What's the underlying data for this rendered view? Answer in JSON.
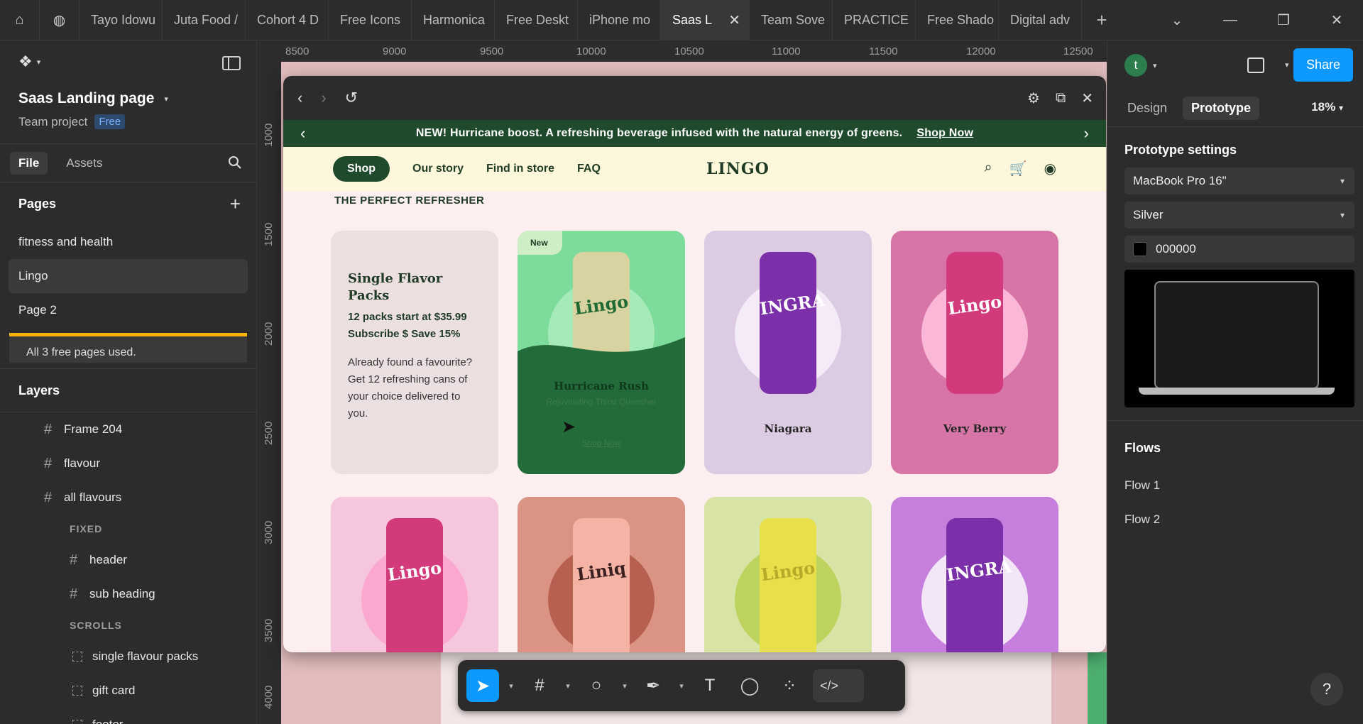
{
  "browser": {
    "tabs": [
      {
        "label": "Tayo Idowu"
      },
      {
        "label": "Juta Food /"
      },
      {
        "label": "Cohort 4 D"
      },
      {
        "label": "Free Icons"
      },
      {
        "label": "Harmonica"
      },
      {
        "label": "Free Deskt"
      },
      {
        "label": "iPhone mo"
      },
      {
        "label": "Saas L"
      },
      {
        "label": "Team Sove"
      },
      {
        "label": "PRACTICE"
      },
      {
        "label": "Free Shado"
      },
      {
        "label": "Digital adv"
      }
    ],
    "active_tab_index": 7
  },
  "left_panel": {
    "project_title": "Saas Landing page",
    "team_label": "Team project",
    "plan_badge": "Free",
    "file_tab": "File",
    "assets_tab": "Assets",
    "pages_heading": "Pages",
    "pages": [
      {
        "label": "fitness and health"
      },
      {
        "label": "Lingo"
      },
      {
        "label": "Page 2"
      }
    ],
    "active_page_index": 1,
    "notice": "All 3 free pages used.",
    "layers_heading": "Layers",
    "layers_top": [
      {
        "label": "Frame 204"
      },
      {
        "label": "flavour"
      },
      {
        "label": "all flavours"
      }
    ],
    "group_fixed": "FIXED",
    "layers_fixed": [
      {
        "label": "header"
      },
      {
        "label": "sub heading"
      }
    ],
    "group_scrolls": "SCROLLS",
    "layers_scrolls": [
      {
        "label": "single flavour packs"
      },
      {
        "label": "gift card"
      },
      {
        "label": "footer"
      }
    ]
  },
  "rulers": {
    "top": [
      "8500",
      "9000",
      "9500",
      "10000",
      "10500",
      "11000",
      "11500",
      "12000",
      "12500"
    ],
    "left": [
      "1000",
      "1500",
      "2000",
      "2500",
      "3000",
      "3500",
      "4000"
    ]
  },
  "site": {
    "announcement": "NEW! Hurricane boost. A refreshing beverage infused with the natural energy of greens.",
    "announcement_link": "Shop Now",
    "nav": {
      "shop": "Shop",
      "our_story": "Our story",
      "find_in_store": "Find in store",
      "faq": "FAQ",
      "logo": "LINGO"
    },
    "eyebrow": "THE PERFECT REFRESHER",
    "info_card": {
      "title": "Single Flavor Packs",
      "price": "12 packs start at $35.99",
      "subscribe": "Subscribe $ Save 15%",
      "description": "Already found a favourite? Get 12 refreshing cans of your choice delivered to you."
    },
    "featured_card": {
      "badge": "New",
      "name": "Hurricane Rush",
      "subtitle": "Rejuvinating Thirst Quencher",
      "link": "Shop Now"
    },
    "cards_row1": [
      {
        "name": "Niagara",
        "can_text": "INGRA",
        "bg": "#dccbe3",
        "disc": "#f5eaf8",
        "can": "#7b2fa8"
      },
      {
        "name": "Very Berry",
        "can_text": "Lingo",
        "bg": "#d776a6",
        "disc": "#fbb7d7",
        "can": "#d23a7b"
      }
    ],
    "cards_row2": [
      {
        "can_text": "Lingo",
        "bg": "#f6c6df",
        "disc": "#fba8d0",
        "can": "#d23a7b"
      },
      {
        "can_text": "Liniq",
        "bg": "#db9484",
        "disc": "#b76050",
        "can": "#f4b3a5"
      },
      {
        "can_text": "Lingo",
        "bg": "#d8e3a6",
        "disc": "#bcd45d",
        "can": "#e8e04a"
      },
      {
        "can_text": "INGRA",
        "bg": "#c67fdc",
        "disc": "#f3e6f7",
        "can": "#7b2fa8"
      }
    ],
    "featured_can_text": "Lingo"
  },
  "right_panel": {
    "avatar_initial": "t",
    "share": "Share",
    "design_tab": "Design",
    "prototype_tab": "Prototype",
    "zoom": "18%",
    "settings_title": "Prototype settings",
    "device": "MacBook Pro 16\"",
    "model": "Silver",
    "background_hex": "000000",
    "flows_heading": "Flows",
    "flows": [
      {
        "label": "Flow 1"
      },
      {
        "label": "Flow 2"
      }
    ],
    "help": "?"
  },
  "colors": {
    "accent": "#0d99ff",
    "brand_green": "#1f4a2b",
    "featured_bg": "#7ddb9c",
    "featured_wave": "#236b3a"
  }
}
